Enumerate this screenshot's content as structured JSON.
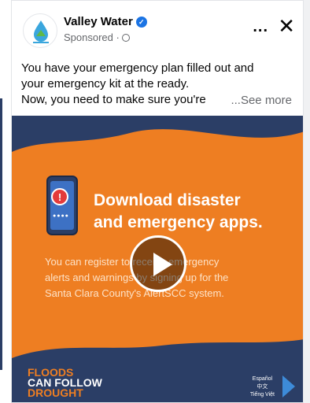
{
  "post": {
    "page_name": "Valley Water",
    "sponsored_label": "Sponsored ·",
    "more_icon": "...",
    "close_icon": "✕",
    "body_lines": [
      "You have your emergency plan filled out and",
      "your emergency kit at the ready.",
      "Now, you need to make sure you're"
    ],
    "see_more": "...See more"
  },
  "creative": {
    "headline_1": "Download disaster",
    "headline_2": "and emergency apps.",
    "sub_lines": [
      "You can register to receive emergency",
      "alerts and warnings by signing up for the",
      "Santa Clara County's AlertSCC system."
    ],
    "floods_1": "FLOODS",
    "floods_2": "CAN FOLLOW",
    "floods_3": "DROUGHT",
    "languages": [
      "Español",
      "中文",
      "Tiếng Việt"
    ]
  },
  "colors": {
    "orange": "#ee7e22",
    "navy": "#2b3e66",
    "verified_blue": "#1b74e4"
  }
}
